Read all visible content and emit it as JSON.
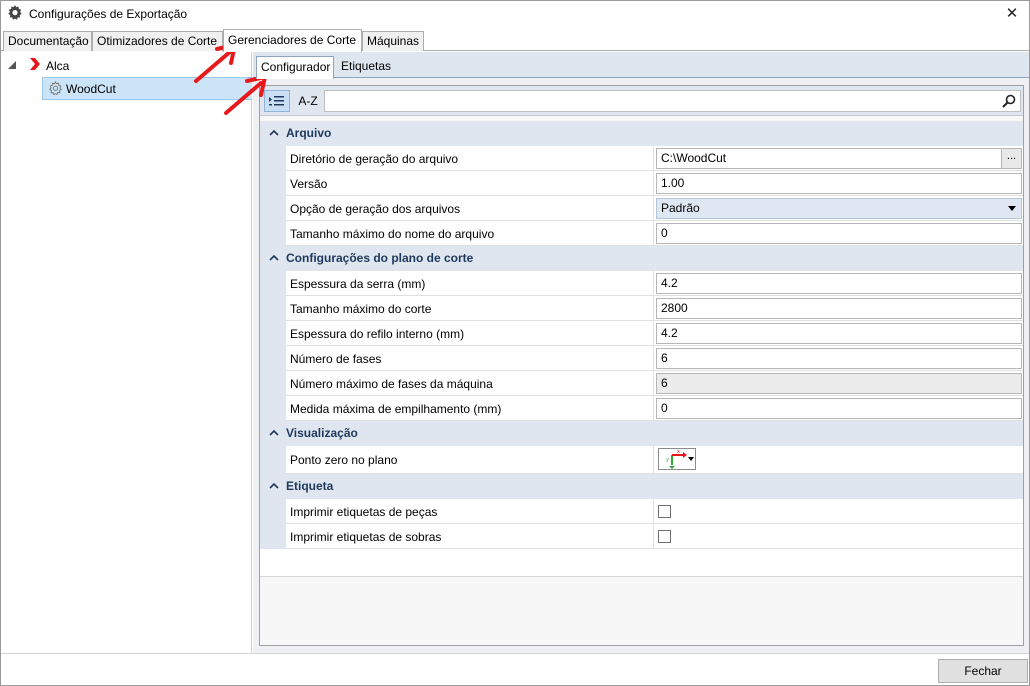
{
  "window": {
    "title": "Configurações de Exportação",
    "close_glyph": "✕"
  },
  "top_tabs": [
    {
      "label": "Documentação"
    },
    {
      "label": "Otimizadores de Corte"
    },
    {
      "label": "Gerenciadores de Corte"
    },
    {
      "label": "Máquinas"
    }
  ],
  "tree": {
    "root_label": "Alca",
    "child_label": "WoodCut"
  },
  "sub_tabs": [
    {
      "label": "Configurador"
    },
    {
      "label": "Etiquetas"
    }
  ],
  "toolbar": {
    "alpha_label": "A-Z",
    "search_value": ""
  },
  "sections": [
    {
      "title": "Arquivo",
      "props": [
        {
          "name": "Diretório de geração do arquivo",
          "value": "C:\\WoodCut",
          "browse": "..."
        },
        {
          "name": "Versão",
          "value": "1.00"
        },
        {
          "name": "Opção de geração dos arquivos",
          "value": "Padrão"
        },
        {
          "name": "Tamanho máximo do nome do arquivo",
          "value": "0"
        }
      ]
    },
    {
      "title": "Configurações do plano de corte",
      "props": [
        {
          "name": "Espessura da serra (mm)",
          "value": "4.2"
        },
        {
          "name": "Tamanho máximo do corte",
          "value": "2800"
        },
        {
          "name": "Espessura do refilo interno (mm)",
          "value": "4.2"
        },
        {
          "name": "Número de fases",
          "value": "6"
        },
        {
          "name": "Número máximo de fases da máquina",
          "value": "6"
        },
        {
          "name": "Medida máxima de empilhamento (mm)",
          "value": "0"
        }
      ]
    },
    {
      "title": "Visualização",
      "props": [
        {
          "name": "Ponto zero no plano"
        }
      ]
    },
    {
      "title": "Etiqueta",
      "props": [
        {
          "name": "Imprimir etiquetas de peças",
          "checked": false
        },
        {
          "name": "Imprimir etiquetas de sobras",
          "checked": false
        }
      ]
    }
  ],
  "footer": {
    "close_label": "Fechar"
  },
  "colors": {
    "accent_arrow": "#e8191c",
    "selection": "#cce4f7",
    "category_bg": "#dfe6f0"
  }
}
